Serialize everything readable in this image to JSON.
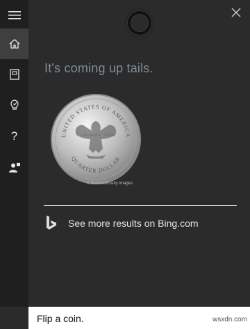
{
  "rail": {
    "items": [
      {
        "name": "home",
        "active": true
      },
      {
        "name": "notebook",
        "active": false
      },
      {
        "name": "ideas",
        "active": false
      },
      {
        "name": "help",
        "active": false
      },
      {
        "name": "feedback",
        "active": false
      }
    ],
    "help_glyph": "?"
  },
  "answer": {
    "text": "It's coming up tails.",
    "credit": "© blackred/Getty Images"
  },
  "coin": {
    "top_text": "UNITED STATES OF AMERICA",
    "bottom_text": "QUARTER DOLLAR",
    "side_left": "E PLURIBUS",
    "side_right": "UNUM"
  },
  "bing": {
    "link_text": "See more results on Bing.com"
  },
  "query": {
    "text": "Flip a coin.",
    "watermark": "wsxdn.com"
  },
  "colors": {
    "background": "#2b2b2b",
    "rail": "#1f1f1f",
    "rail_active": "#3f3f3f",
    "answer_text": "#7f8c94"
  }
}
